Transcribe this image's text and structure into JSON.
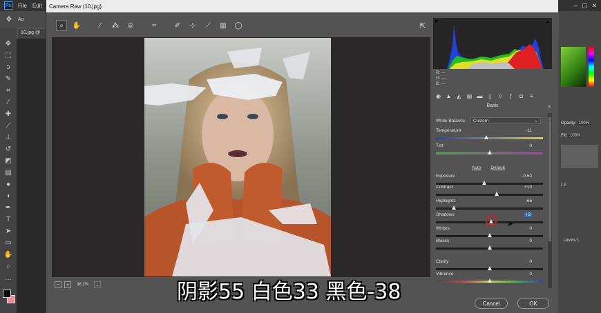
{
  "photoshop": {
    "menu": [
      "File",
      "Edit"
    ],
    "doc_tab": "10.jpg @",
    "options_label": "Au",
    "right": {
      "opacity_label": "Opacity:",
      "opacity_value": "100%",
      "fill_label": "Fill:",
      "fill_value": "100%",
      "layer_label": "Levels 1",
      "layer_label2": "r 2"
    }
  },
  "dialog": {
    "title": "Camera Raw (10.jpg)",
    "zoom": "36.1%",
    "cancel_label": "Cancel",
    "ok_label": "OK"
  },
  "sidepanel": {
    "rgb": {
      "r": "R:  ---",
      "g": "G:  ---",
      "b": "B:  ---"
    },
    "panel_title": "Basic",
    "white_balance_label": "White Balance:",
    "white_balance_value": "Custom",
    "auto_label": "Auto",
    "default_label": "Default",
    "sliders": [
      {
        "label": "Temperature",
        "value": "-11",
        "pos": 0.47
      },
      {
        "label": "Tint",
        "value": "0",
        "pos": 0.5
      },
      {
        "label": "Exposure",
        "value": "-0,50",
        "pos": 0.45
      },
      {
        "label": "Contrast",
        "value": "+13",
        "pos": 0.565
      },
      {
        "label": "Highlights",
        "value": "-66",
        "pos": 0.17
      },
      {
        "label": "Shadows",
        "value": "+3",
        "pos": 0.515
      },
      {
        "label": "Whites",
        "value": "0",
        "pos": 0.5
      },
      {
        "label": "Blacks",
        "value": "0",
        "pos": 0.5
      },
      {
        "label": "Clarity",
        "value": "0",
        "pos": 0.5
      },
      {
        "label": "Vibrance",
        "value": "0",
        "pos": 0.5
      }
    ]
  },
  "subtitle": "阴影55 白色33 黑色-38",
  "colors": {
    "accent": "#2f6fb8",
    "cursor_ring": "#d02020"
  }
}
